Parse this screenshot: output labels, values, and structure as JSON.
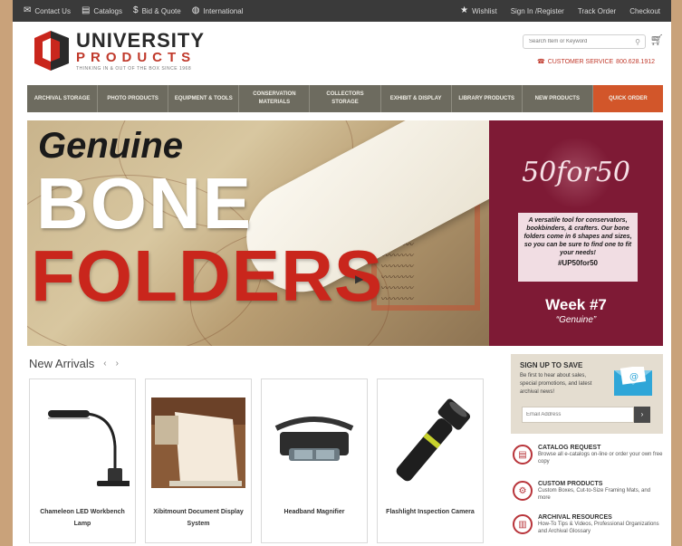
{
  "topbar": {
    "left": [
      {
        "icon": "mail-icon",
        "label": "Contact Us"
      },
      {
        "icon": "catalog-icon",
        "label": "Catalogs"
      },
      {
        "icon": "dollar-icon",
        "label": "Bid & Quote"
      },
      {
        "icon": "globe-icon",
        "label": "International"
      }
    ],
    "right": [
      {
        "icon": "star-icon",
        "label": "Wishlist"
      },
      {
        "label": "Sign In /Register"
      },
      {
        "label": "Track Order"
      },
      {
        "label": "Checkout"
      }
    ]
  },
  "header": {
    "logo_title": "UNIVERSITY",
    "logo_sub": "PRODUCTS",
    "logo_tagline": "THINKING IN & OUT OF THE BOX SINCE 1968",
    "search_placeholder": "Search Item or Keyword",
    "customer_service_label": "CUSTOMER SERVICE",
    "customer_service_phone": "800.628.1912"
  },
  "nav": [
    "ARCHIVAL STORAGE",
    "PHOTO PRODUCTS",
    "EQUIPMENT & TOOLS",
    "CONSERVATION MATERIALS",
    "COLLECTORS STORAGE",
    "EXHIBIT & DISPLAY",
    "LIBRARY PRODUCTS",
    "NEW PRODUCTS",
    "QUICK ORDER"
  ],
  "hero": {
    "genuine": "Genuine",
    "bone": "BONE",
    "folders": "FOLDERS",
    "badge": "50for50",
    "promo_text": "A versatile tool for conservators, bookbinders, & crafters. Our bone folders come in 6 shapes and sizes, so you can be sure to find one to fit your needs!",
    "hashtag": "#UP50for50",
    "week": "Week #7",
    "week_sub": "“Genuine”"
  },
  "new_arrivals": {
    "title": "New Arrivals",
    "products": [
      {
        "name": "Chameleon LED Workbench Lamp"
      },
      {
        "name": "Xibitmount Document Display System"
      },
      {
        "name": "Headband Magnifier"
      },
      {
        "name": "Flashlight Inspection Camera"
      }
    ]
  },
  "signup": {
    "title": "SIGN UP TO SAVE",
    "text": "Be first to hear about sales, special promotions, and latest archival news!",
    "email_placeholder": "Email Address",
    "submit": "›"
  },
  "resources": [
    {
      "icon": "catalog-request-icon",
      "title": "CATALOG REQUEST",
      "desc": "Browse all e-catalogs on-line or order your own free copy"
    },
    {
      "icon": "custom-products-icon",
      "title": "CUSTOM PRODUCTS",
      "desc": "Custom Boxes, Cut-to-Size Framing Mats, and more"
    },
    {
      "icon": "archival-resources-icon",
      "title": "ARCHIVAL RESOURCES",
      "desc": "How-To Tips & Videos, Professional Organizations and Archival Glossary"
    }
  ],
  "colors": {
    "topbar": "#3a3a3a",
    "nav": "#6d6b5f",
    "quick_order": "#d2562a",
    "brand_red": "#c9261c",
    "promo_maroon": "#7e1a35"
  }
}
